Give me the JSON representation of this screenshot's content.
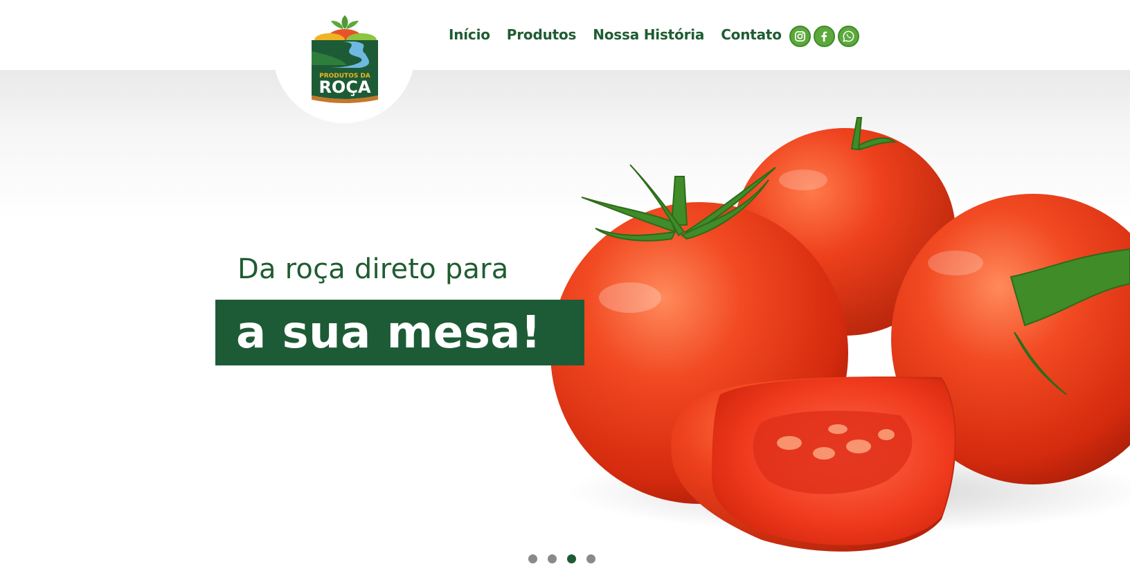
{
  "brand": {
    "logo_line1": "PRODUTOS DA",
    "logo_line2": "ROÇA",
    "logo_icon": "logo-icon"
  },
  "nav": {
    "items": [
      {
        "label": "Início"
      },
      {
        "label": "Produtos"
      },
      {
        "label": "Nossa História"
      },
      {
        "label": "Contato"
      }
    ]
  },
  "social": {
    "icons": [
      "instagram-icon",
      "facebook-icon",
      "whatsapp-icon"
    ]
  },
  "hero": {
    "line1": "Da roça direto para",
    "line2": "a sua mesa!"
  },
  "carousel": {
    "slide_count": 4,
    "active_slide": 3
  },
  "colors": {
    "brand_green": "#1d5b36",
    "accent_green": "#5ca83c",
    "tomato_red": "#e8321a"
  }
}
